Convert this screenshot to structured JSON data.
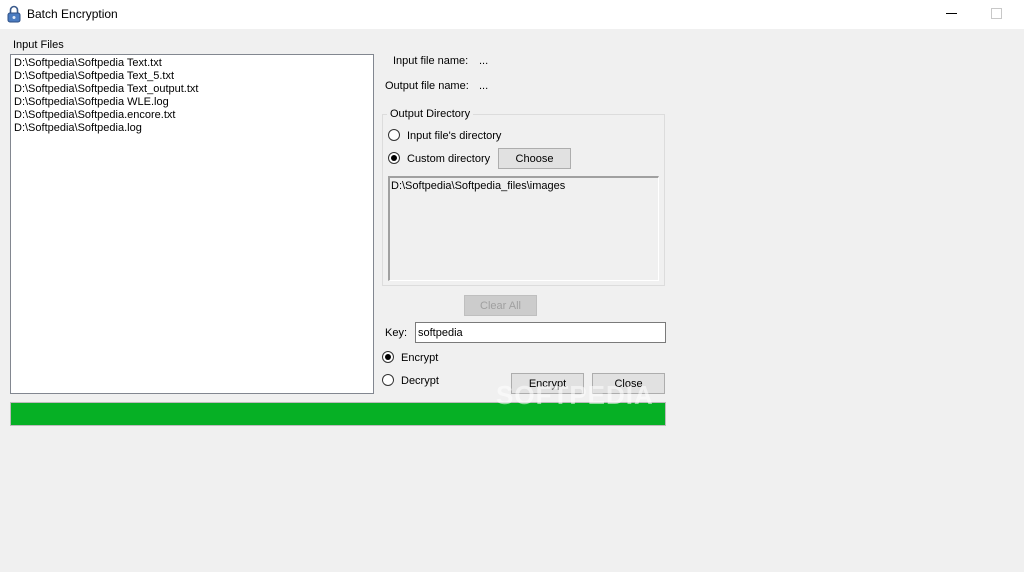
{
  "window": {
    "title": "Batch Encryption",
    "app_icon": "padlock-icon",
    "controls": [
      "minimize-icon",
      "maximize-icon"
    ]
  },
  "input_files": {
    "label": "Input Files",
    "items": [
      "D:\\Softpedia\\Softpedia Text.txt",
      "D:\\Softpedia\\Softpedia Text_5.txt",
      "D:\\Softpedia\\Softpedia Text_output.txt",
      "D:\\Softpedia\\Softpedia WLE.log",
      "D:\\Softpedia\\Softpedia.encore.txt",
      "D:\\Softpedia\\Softpedia.log"
    ]
  },
  "file_info": {
    "input_label": "Input file name:",
    "input_value": "...",
    "output_label": "Output file name:",
    "output_value": "..."
  },
  "output_directory": {
    "legend": "Output Directory",
    "option_input": "Input file's directory",
    "option_custom": "Custom directory",
    "selected": "custom",
    "choose_label": "Choose",
    "path": "D:\\Softpedia\\Softpedia_files\\images"
  },
  "clear_all_label": "Clear All",
  "key": {
    "label": "Key:",
    "value": "softpedia"
  },
  "mode": {
    "encrypt_label": "Encrypt",
    "decrypt_label": "Decrypt",
    "selected": "encrypt"
  },
  "encrypt_button_label": "Encrypt",
  "close_button_label": "Close",
  "progress": {
    "value": 1.0,
    "color": "#06b025"
  },
  "watermark": "SOFTPEDIA"
}
